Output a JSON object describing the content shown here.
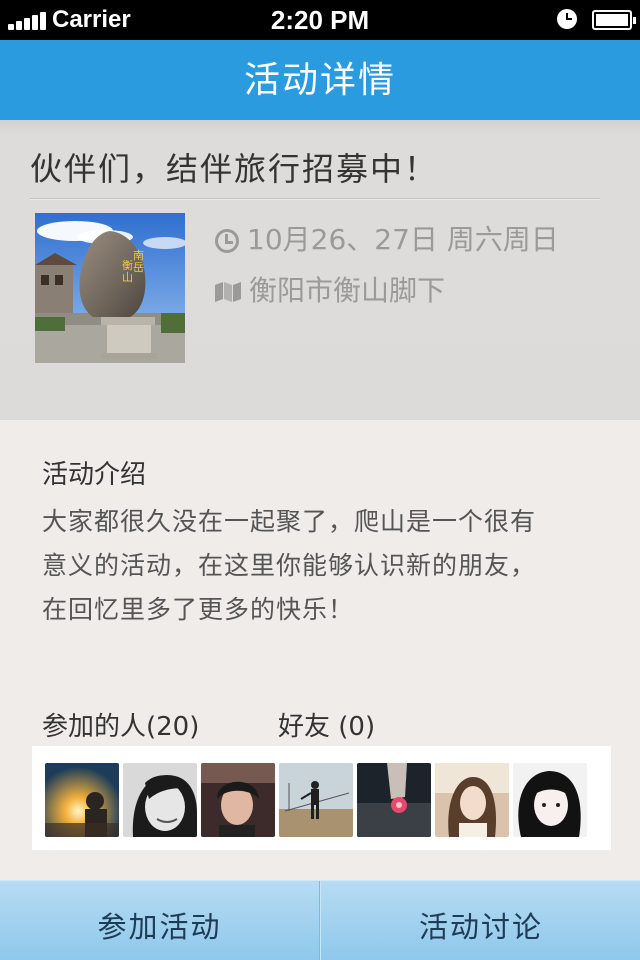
{
  "status_bar": {
    "carrier": "Carrier",
    "time": "2:20 PM",
    "icons": [
      "signal-icon",
      "alarm-icon",
      "battery-icon"
    ]
  },
  "nav": {
    "title": "活动详情"
  },
  "event": {
    "title": "伙伴们，结伴旅行招募中！",
    "date": "10月26、27日  周六周日",
    "location": "衡阳市衡山脚下",
    "photo_caption": "南岳衡山"
  },
  "intro": {
    "heading": "活动介绍",
    "lines": [
      "大家都很久没在一起聚了，爬山是一个很有",
      "意义的活动，在这里你能够认识新的朋友，",
      "在回忆里多了更多的快乐！"
    ]
  },
  "participants": {
    "label": "参加的人(20)",
    "friends_label": "好友 (0)",
    "count": 20,
    "friends_count": 0,
    "visible_avatars": 7
  },
  "actions": {
    "join": "参加活动",
    "discuss": "活动讨论"
  },
  "colors": {
    "nav_bar": "#2b9be0",
    "bottom_bar": "#a3d2ef",
    "background": "#efecea"
  }
}
